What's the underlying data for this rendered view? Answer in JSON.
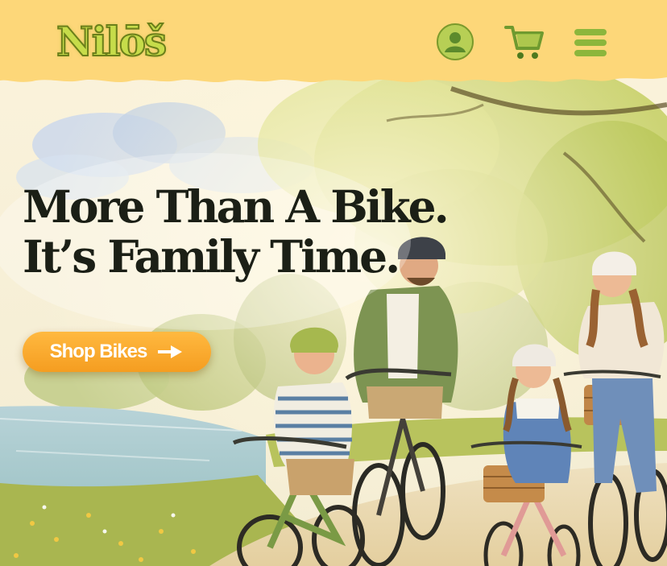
{
  "header": {
    "logo_text": "Nilōš",
    "account_icon": "account-icon",
    "cart_icon": "cart-icon",
    "menu_icon": "hamburger-menu-icon"
  },
  "hero": {
    "headline_line1": "More Than A Bike.",
    "headline_line2": "It’s Family Time.",
    "cta_label": "Shop Bikes",
    "cta_icon": "arrow-right-icon"
  },
  "colors": {
    "header_bg": "#fdd779",
    "cta_orange": "#f8a92a",
    "headline": "#1b1f16",
    "logo_green": "#c6dc4a"
  }
}
